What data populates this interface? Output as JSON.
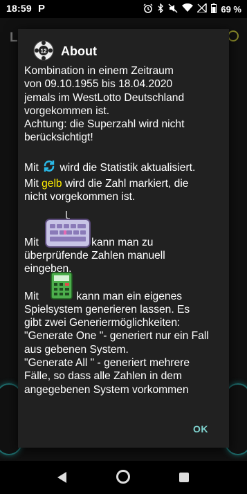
{
  "status_bar": {
    "time": "18:59",
    "app_badge": "P",
    "battery": "69 %"
  },
  "background_app": {
    "title_letter": "L"
  },
  "dialog": {
    "title": "About",
    "icon_badge": "12",
    "text": {
      "line0": "Kombination in einem Zeitraum",
      "line1": "von 09.10.1955 bis 18.04.2020",
      "line2": "jemals im WestLotto Deutschland",
      "line3": "vorgekommen ist.",
      "line4": "Achtung: die Superzahl wird nicht",
      "line5": "berücksichtigt!",
      "refresh_pre": "Mit ",
      "refresh_post": " wird die Statistik aktualisiert.",
      "yellow_pre": "Mit ",
      "yellow_word": "gelb",
      "yellow_post": " wird die Zahl markiert, die",
      "yellow_line2": "nicht vorgekommen ist.",
      "keyboard_pre": "Mit ",
      "keyboard_post": "kann man zu",
      "keyboard_line2": "überprüfende Zahlen manuell",
      "keyboard_line3": "eingeben.",
      "calc_pre": "Mit ",
      "calc_post": " kann man ein eigenes",
      "calc_line2": "Spielsystem generieren lassen. Es",
      "calc_line3": "gibt zwei Generiermöglichkeiten:",
      "calc_line4": "\"Generate One \"- generiert nur ein Fall",
      "calc_line5": "aus gebenen System.",
      "calc_line6": "\"Generate All \" - generiert mehrere",
      "calc_line7": "Fälle, so dass alle Zahlen in dem",
      "calc_line8": "angegebenen System vorkommen"
    },
    "ok_label": "OK"
  },
  "colors": {
    "accent": "#7fd4d0",
    "highlight": "#ffee00",
    "dialog_bg": "#212121"
  },
  "icons": [
    "p-app-icon",
    "alarm-icon",
    "bluetooth-icon",
    "mute-icon",
    "wifi-icon",
    "signal-icon",
    "battery-icon",
    "lotto-ball-icon",
    "refresh-icon",
    "keyboard-icon",
    "calculator-icon",
    "back-icon",
    "home-icon",
    "recents-icon"
  ]
}
